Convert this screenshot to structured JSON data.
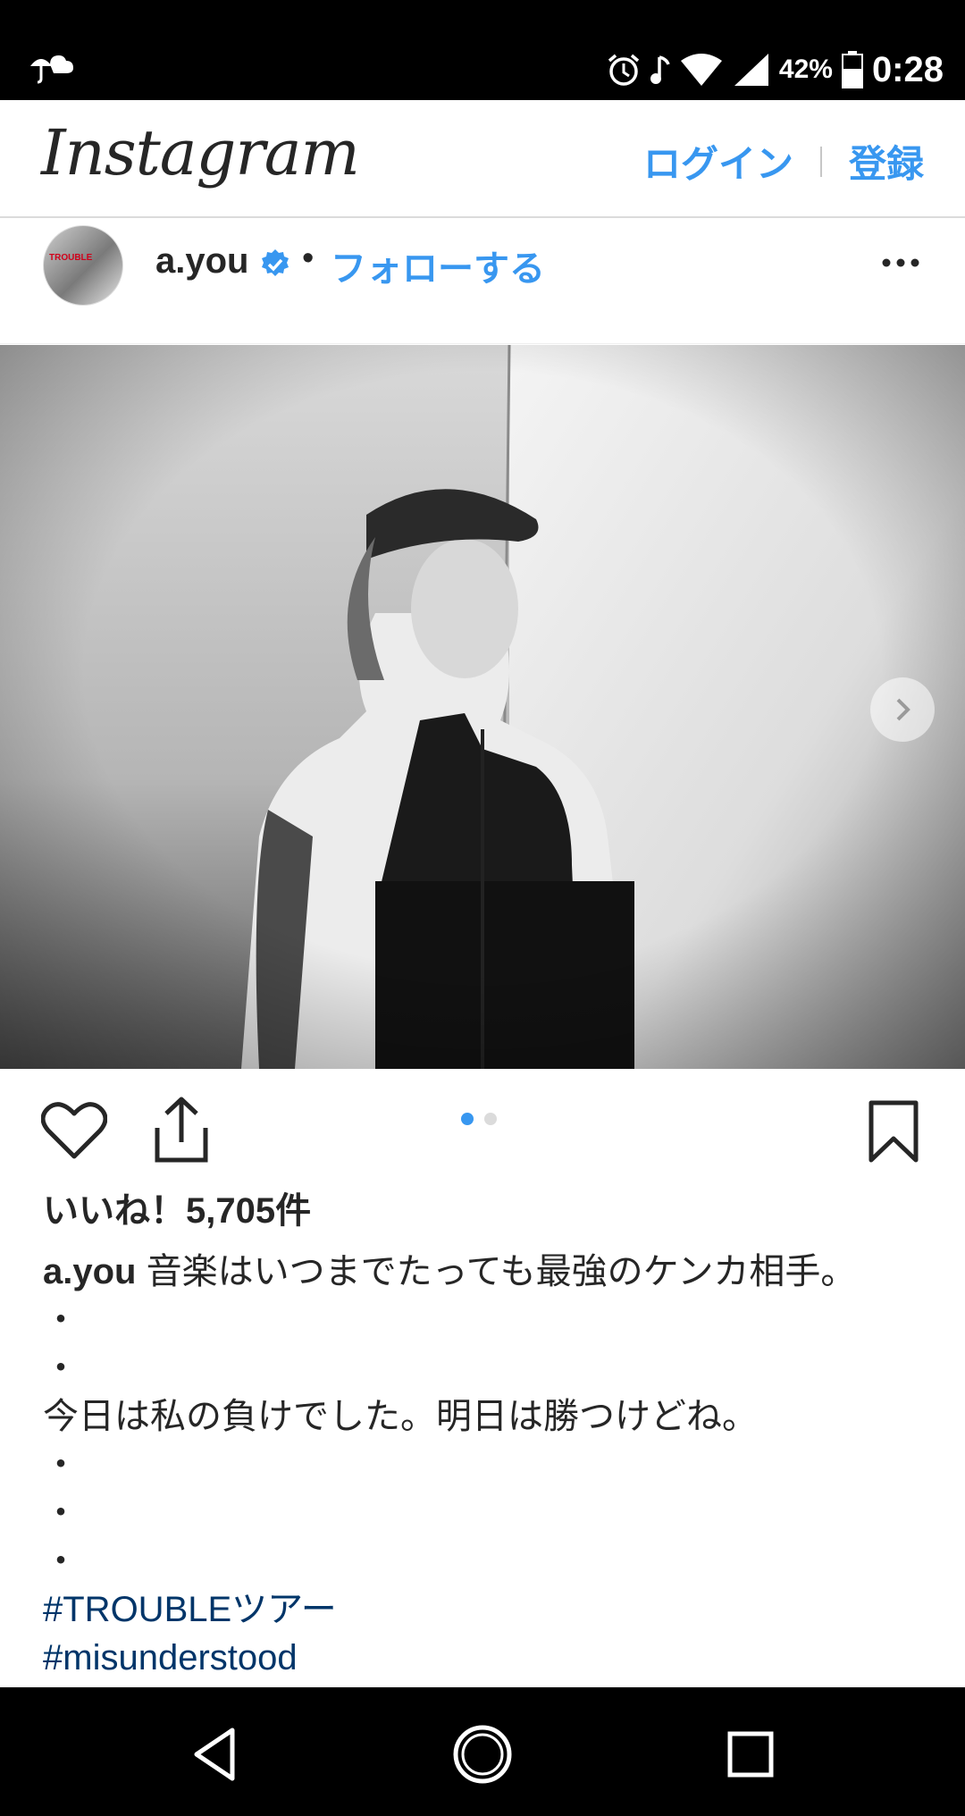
{
  "status_bar": {
    "battery_percent": "42%",
    "time": "0:28",
    "icons": [
      "umbrella-cloud-icon",
      "alarm-icon",
      "music-note-icon",
      "wifi-icon",
      "signal-icon",
      "battery-icon"
    ]
  },
  "header": {
    "logo": "Instagram",
    "login": "ログイン",
    "signup": "登録"
  },
  "post": {
    "username": "a.you",
    "follow_label": "フォローする",
    "separator": "•",
    "avatar_text": "TROUBLE",
    "carousel": {
      "count": 2,
      "active_index": 0
    },
    "likes": "いいね！5,705件",
    "caption": {
      "user": "a.you",
      "lines": [
        "音楽はいつまでたっても最強のケンカ相手。",
        "・",
        "・",
        "今日は私の負けでした。明日は勝つけどね。",
        "・",
        "・",
        "・"
      ],
      "hashtags": [
        "#TROUBLEツアー",
        "#misunderstood"
      ]
    }
  },
  "colors": {
    "accent": "#3897f0",
    "hashtag": "#003569",
    "text": "#262626",
    "bar": "#000000"
  }
}
